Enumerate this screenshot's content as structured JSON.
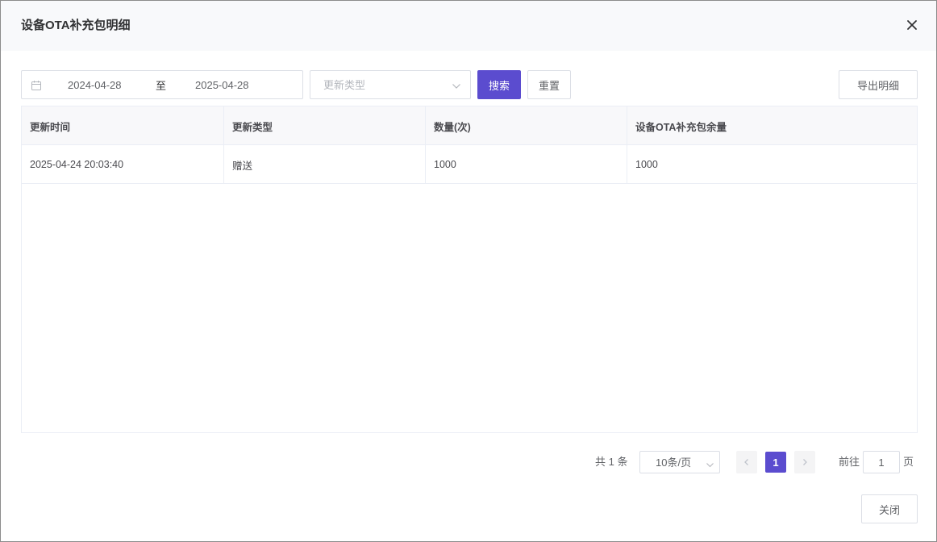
{
  "dialog": {
    "title": "设备OTA补充包明细",
    "close_icon": "close-icon"
  },
  "filters": {
    "date_icon": "calendar-icon",
    "start_date": "2024-04-28",
    "separator": "至",
    "end_date": "2025-04-28",
    "type_placeholder": "更新类型",
    "search_label": "搜索",
    "reset_label": "重置",
    "export_label": "导出明细"
  },
  "table": {
    "columns": [
      "更新时间",
      "更新类型",
      "数量(次)",
      "设备OTA补充包余量"
    ],
    "rows": [
      [
        "2025-04-24 20:03:40",
        "赠送",
        "1000",
        "1000"
      ]
    ]
  },
  "pagination": {
    "total_text": "共 1 条",
    "page_size": "10条/页",
    "current_page": "1",
    "goto_label": "前往",
    "goto_value": "1",
    "goto_unit": "页"
  },
  "footer": {
    "close_label": "关闭"
  },
  "colors": {
    "primary": "#5b4ccf",
    "border": "#dcdfe6",
    "header_bg": "#f8f9fb"
  }
}
